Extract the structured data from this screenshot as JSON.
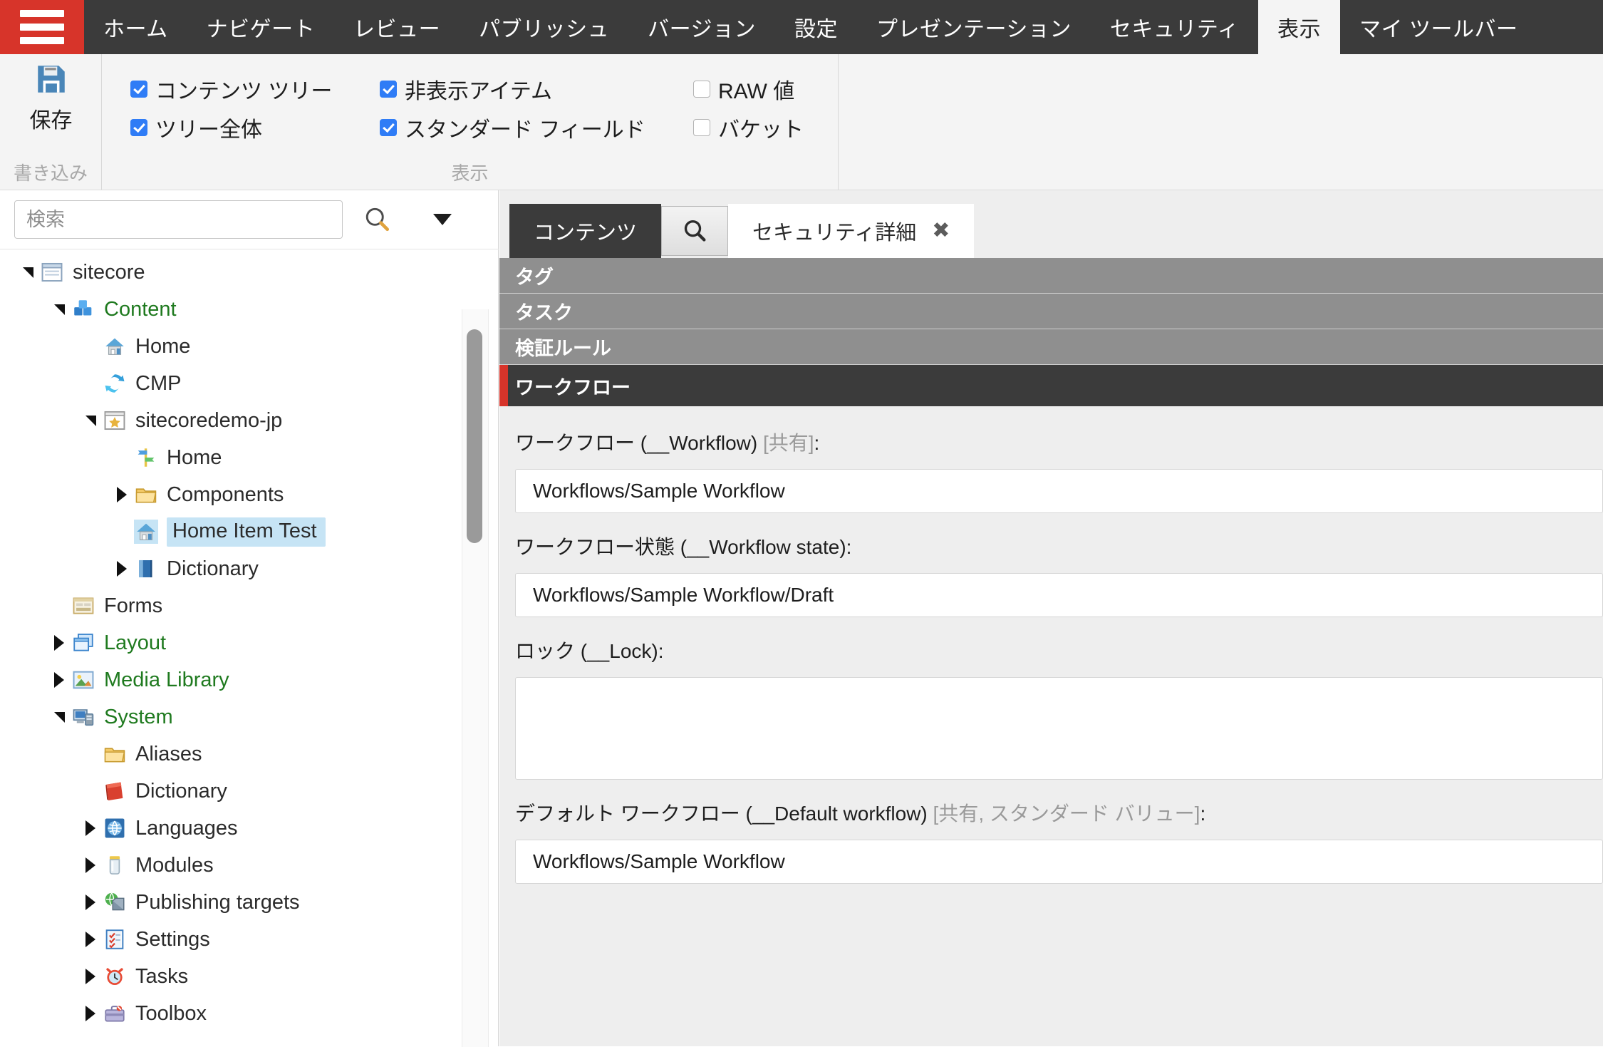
{
  "menubar": {
    "hamburger_icon": "hamburger-menu-icon",
    "tabs": [
      {
        "label": "ホーム",
        "active": false
      },
      {
        "label": "ナビゲート",
        "active": false
      },
      {
        "label": "レビュー",
        "active": false
      },
      {
        "label": "パブリッシュ",
        "active": false
      },
      {
        "label": "バージョン",
        "active": false
      },
      {
        "label": "設定",
        "active": false
      },
      {
        "label": "プレゼンテーション",
        "active": false
      },
      {
        "label": "セキュリティ",
        "active": false
      },
      {
        "label": "表示",
        "active": true
      },
      {
        "label": "マイ ツールバー",
        "active": false
      }
    ]
  },
  "ribbon": {
    "save_group": {
      "button_label": "保存",
      "icon": "floppy-disk-icon",
      "caption": "書き込み"
    },
    "view_group": {
      "caption": "表示",
      "checkboxes": [
        {
          "label": "コンテンツ ツリー",
          "checked": true
        },
        {
          "label": "非表示アイテム",
          "checked": true
        },
        {
          "label": "RAW 値",
          "checked": false
        },
        {
          "label": "ツリー全体",
          "checked": true
        },
        {
          "label": "スタンダード フィールド",
          "checked": true
        },
        {
          "label": "バケット",
          "checked": false
        }
      ]
    }
  },
  "sidebar": {
    "search": {
      "placeholder": "検索",
      "value": "",
      "search_icon": "magnifier-icon",
      "dropdown_icon": "chevron-down-icon"
    },
    "tree": [
      {
        "label": "sitecore",
        "indent": 0,
        "expander": "down",
        "icon": "window-icon",
        "green": false,
        "selected": false
      },
      {
        "label": "Content",
        "indent": 1,
        "expander": "down",
        "icon": "cubes-icon",
        "green": true,
        "selected": false
      },
      {
        "label": "Home",
        "indent": 2,
        "expander": "none",
        "icon": "home-icon",
        "green": false,
        "selected": false
      },
      {
        "label": "CMP",
        "indent": 2,
        "expander": "none",
        "icon": "sync-icon",
        "green": false,
        "selected": false
      },
      {
        "label": "sitecoredemo-jp",
        "indent": 2,
        "expander": "down",
        "icon": "star-window-icon",
        "green": false,
        "selected": false
      },
      {
        "label": "Home",
        "indent": 3,
        "expander": "none",
        "icon": "signpost-icon",
        "green": false,
        "selected": false
      },
      {
        "label": "Components",
        "indent": 3,
        "expander": "right",
        "icon": "folder-icon",
        "green": false,
        "selected": false
      },
      {
        "label": "Home Item Test",
        "indent": 3,
        "expander": "none",
        "icon": "home-icon",
        "green": false,
        "selected": true
      },
      {
        "label": "Dictionary",
        "indent": 3,
        "expander": "right",
        "icon": "book-blue-icon",
        "green": false,
        "selected": false
      },
      {
        "label": "Forms",
        "indent": 1,
        "expander": "none",
        "icon": "form-icon",
        "green": false,
        "selected": false
      },
      {
        "label": "Layout",
        "indent": 1,
        "expander": "right",
        "icon": "layers-icon",
        "green": true,
        "selected": false
      },
      {
        "label": "Media Library",
        "indent": 1,
        "expander": "right",
        "icon": "picture-icon",
        "green": true,
        "selected": false
      },
      {
        "label": "System",
        "indent": 1,
        "expander": "down",
        "icon": "server-icon",
        "green": true,
        "selected": false
      },
      {
        "label": "Aliases",
        "indent": 2,
        "expander": "none",
        "icon": "folder-icon",
        "green": false,
        "selected": false
      },
      {
        "label": "Dictionary",
        "indent": 2,
        "expander": "none",
        "icon": "book-red-icon",
        "green": false,
        "selected": false
      },
      {
        "label": "Languages",
        "indent": 2,
        "expander": "right",
        "icon": "globe-icon",
        "green": false,
        "selected": false
      },
      {
        "label": "Modules",
        "indent": 2,
        "expander": "right",
        "icon": "jar-icon",
        "green": false,
        "selected": false
      },
      {
        "label": "Publishing targets",
        "indent": 2,
        "expander": "right",
        "icon": "publish-icon",
        "green": false,
        "selected": false
      },
      {
        "label": "Settings",
        "indent": 2,
        "expander": "right",
        "icon": "checklist-icon",
        "green": false,
        "selected": false
      },
      {
        "label": "Tasks",
        "indent": 2,
        "expander": "right",
        "icon": "alarm-clock-icon",
        "green": false,
        "selected": false
      },
      {
        "label": "Toolbox",
        "indent": 2,
        "expander": "right",
        "icon": "toolbox-icon",
        "green": false,
        "selected": false
      }
    ]
  },
  "content": {
    "tabs": [
      {
        "label": "コンテンツ",
        "type": "dark",
        "closable": false
      },
      {
        "label": "",
        "type": "search",
        "icon": "magnifier-icon",
        "closable": false
      },
      {
        "label": "セキュリティ詳細",
        "type": "light",
        "closable": true,
        "close_glyph": "✖"
      }
    ],
    "sections": [
      {
        "title": "タグ",
        "active": false
      },
      {
        "title": "タスク",
        "active": false
      },
      {
        "title": "検証ルール",
        "active": false
      },
      {
        "title": "ワークフロー",
        "active": true
      }
    ],
    "fields": [
      {
        "label": "ワークフロー (__Workflow)",
        "meta": " [共有]",
        "suffix": ":",
        "value": "Workflows/Sample Workflow",
        "tall": false
      },
      {
        "label": "ワークフロー状態 (__Workflow state)",
        "meta": "",
        "suffix": ":",
        "value": "Workflows/Sample Workflow/Draft",
        "tall": false
      },
      {
        "label": "ロック (__Lock)",
        "meta": "",
        "suffix": ":",
        "value": "",
        "tall": true
      },
      {
        "label": "デフォルト ワークフロー (__Default workflow)",
        "meta": " [共有, スタンダード バリュー]",
        "suffix": ":",
        "value": "Workflows/Sample Workflow",
        "tall": false
      }
    ]
  },
  "colors": {
    "brand_red": "#d7342a",
    "menubar_dark": "#3b3b3b",
    "section_gray": "#8f8f8f",
    "checkbox_blue": "#2f7cf6",
    "tree_green": "#1f7a1f",
    "selection_blue": "#c6e4f5"
  }
}
